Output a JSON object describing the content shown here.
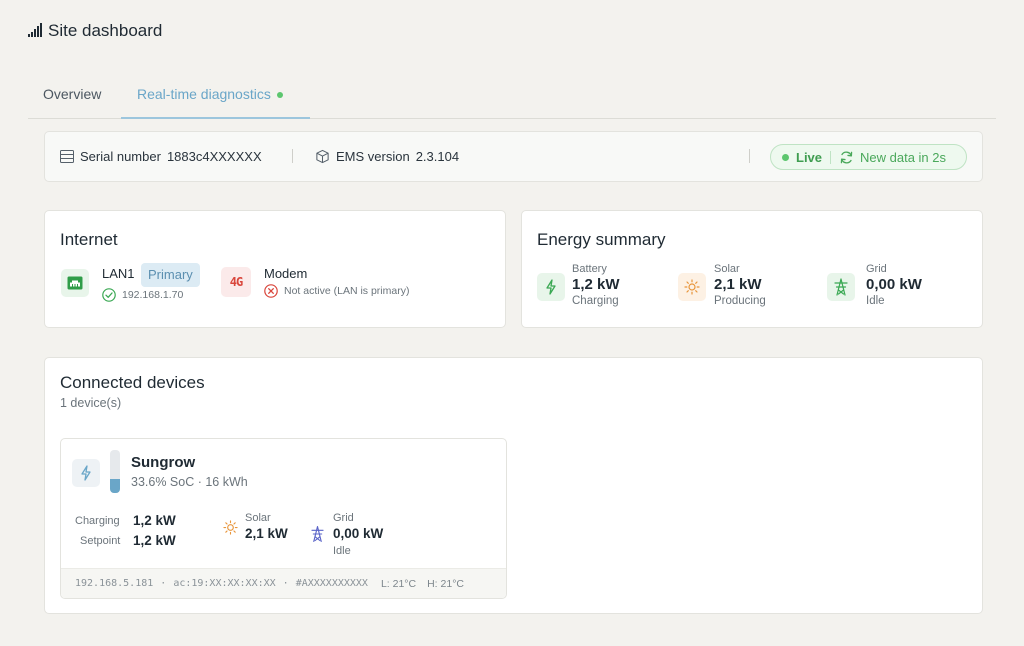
{
  "header": {
    "title": "Site dashboard",
    "icon": "signal-bars-icon"
  },
  "tabs": [
    {
      "label": "Overview",
      "active": false
    },
    {
      "label": "Real-time diagnostics",
      "active": true
    }
  ],
  "info_bar": {
    "serial_label": "Serial number",
    "serial_value": "1883c4XXXXXX",
    "ems_label": "EMS version",
    "ems_value": "2.3.104",
    "live_label": "Live",
    "new_data": "New data in 2s"
  },
  "internet": {
    "title": "Internet",
    "lan": {
      "name": "LAN1",
      "badge": "Primary",
      "ip": "192.168.1.70",
      "status": "connected"
    },
    "modem": {
      "icon_text": "4G",
      "name": "Modem",
      "status": "Not active (LAN is primary)"
    }
  },
  "energy": {
    "title": "Energy summary",
    "battery": {
      "label": "Battery",
      "value": "1,2 kW",
      "status": "Charging"
    },
    "solar": {
      "label": "Solar",
      "value": "2,1 kW",
      "status": "Producing"
    },
    "grid": {
      "label": "Grid",
      "value": "0,00 kW",
      "status": "Idle"
    }
  },
  "devices": {
    "title": "Connected devices",
    "count": "1 device(s)",
    "items": [
      {
        "name": "Sungrow",
        "soc_fraction": 0.336,
        "subtitle": "33.6% SoC · 16 kWh",
        "charging_label": "Charging",
        "charging_value": "1,2 kW",
        "setpoint_label": "Setpoint",
        "setpoint_value": "1,2 kW",
        "solar_label": "Solar",
        "solar_value": "2,1 kW",
        "grid_label": "Grid",
        "grid_value": "0,00 kW",
        "grid_status": "Idle",
        "ip": "192.168.5.181",
        "mac": "ac:19:XX:XX:XX:XX",
        "serial": "#AXXXXXXXXXX",
        "low_temp": "L: 21°C",
        "high_temp": "H: 21°C"
      }
    ]
  },
  "colors": {
    "accent_blue": "#6aa6c8",
    "live_green": "#5cc66e",
    "error_red": "#d9453b",
    "solar_orange": "#e8953a",
    "grid_indigo": "#5a64c8"
  }
}
